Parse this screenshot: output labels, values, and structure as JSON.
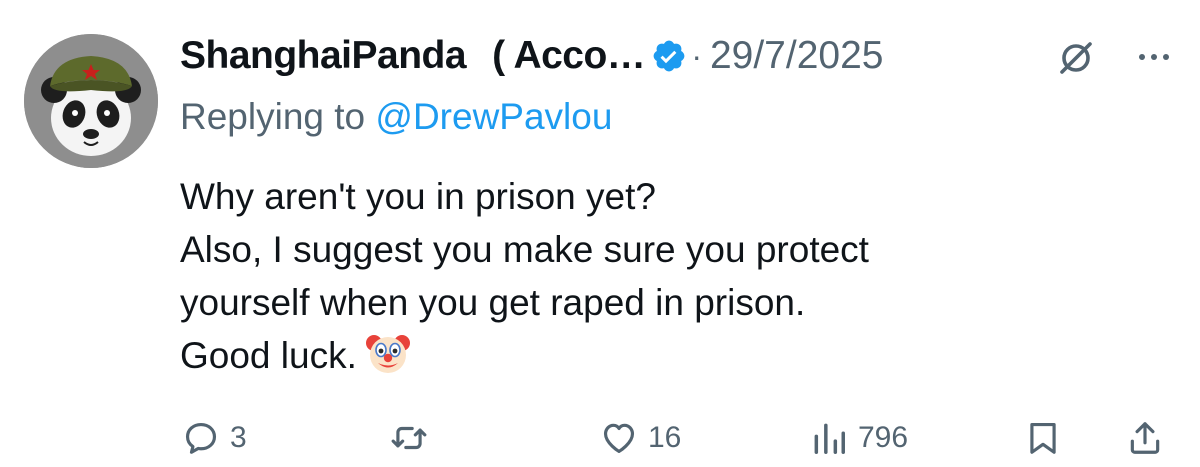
{
  "tweet": {
    "display_name": "ShanghaiPanda",
    "display_name_extra": "( Acco…",
    "verified": true,
    "separator": "·",
    "timestamp": "29/7/2025",
    "reply_prefix": "Replying to ",
    "reply_handle": "@DrewPavlou",
    "body_lines": [
      "Why aren't you in prison yet?",
      "Also, I suggest you make sure you protect",
      "yourself when you get raped in prison.",
      "Good luck."
    ],
    "emoji": "clown-face"
  },
  "actions": {
    "replies": "3",
    "reposts": "",
    "likes": "16",
    "views": "796"
  },
  "colors": {
    "accent": "#1d9bf0",
    "muted": "#536471",
    "text": "#0f1419"
  },
  "icons": [
    "avatar-panda",
    "verified-badge-icon",
    "grok-icon",
    "more-icon",
    "reply-icon",
    "repost-icon",
    "like-icon",
    "views-icon",
    "bookmark-icon",
    "share-icon"
  ]
}
